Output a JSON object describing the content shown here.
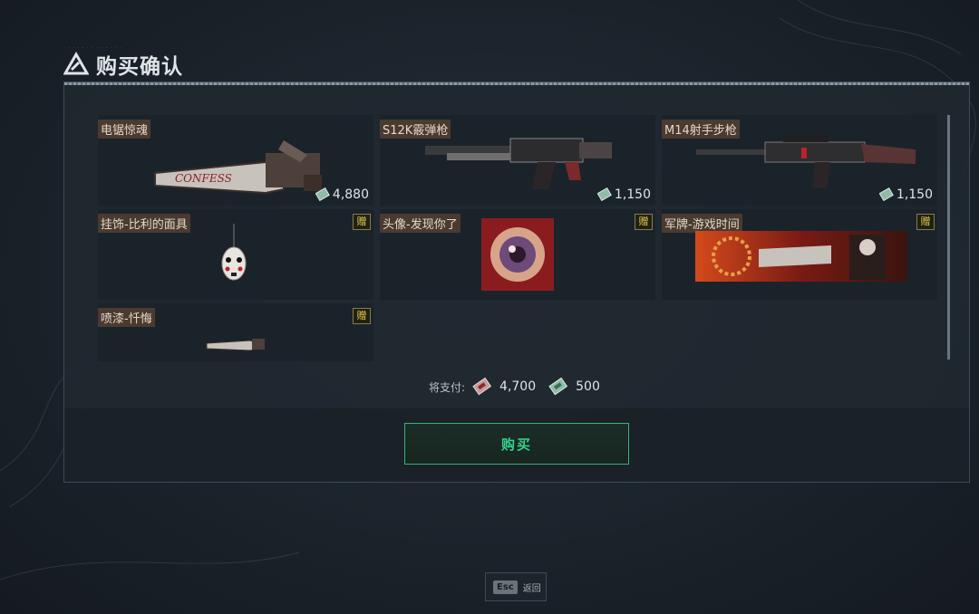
{
  "header": {
    "title": "购买确认",
    "logo_icon": "triangle-logo-icon"
  },
  "items": [
    {
      "name": "电锯惊魂",
      "price": "4,880",
      "gift": null,
      "art": "chainsaw"
    },
    {
      "name": "S12K霰弹枪",
      "price": "1,150",
      "gift": null,
      "art": "shotgun"
    },
    {
      "name": "M14射手步枪",
      "price": "1,150",
      "gift": null,
      "art": "rifle"
    },
    {
      "name": "挂饰-比利的面具",
      "price": null,
      "gift": "赠",
      "art": "mask"
    },
    {
      "name": "头像-发现你了",
      "price": null,
      "gift": "赠",
      "art": "avatar"
    },
    {
      "name": "军牌-游戏时间",
      "price": null,
      "gift": "赠",
      "art": "banner"
    },
    {
      "name": "喷漆-忏悔",
      "price": null,
      "gift": "赠",
      "art": "spray"
    }
  ],
  "payment": {
    "label": "将支付:",
    "amount_a": "4,700",
    "amount_b": "500",
    "currency_a_icon": "red-ticket-icon",
    "currency_b_icon": "green-ticket-icon"
  },
  "buy_button": {
    "label": "购买"
  },
  "esc_hint": {
    "key": "Esc",
    "label": "返回"
  },
  "colors": {
    "accent": "#36b373",
    "gift": "#e8c84e",
    "name_bg": "#4a3a30"
  }
}
